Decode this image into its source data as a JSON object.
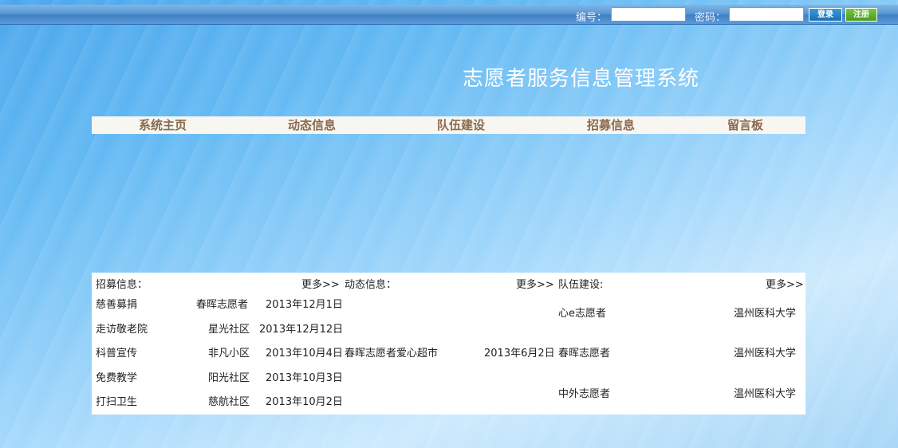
{
  "login": {
    "id_label": "编号：",
    "password_label": "密码：",
    "id_value": "",
    "password_value": "",
    "login_button": "登录",
    "register_button": "注册"
  },
  "site_title": "志愿者服务信息管理系统",
  "nav": [
    "系统主页",
    "动态信息",
    "队伍建设",
    "招募信息",
    "留言板"
  ],
  "recruit": {
    "header": "招募信息：",
    "more": "更多>>",
    "items": [
      {
        "title": "慈善募捐",
        "org": "春晖志愿者",
        "date": "2013年12月1日"
      },
      {
        "title": "走访敬老院",
        "org": "星光社区",
        "date": "2013年12月12日"
      },
      {
        "title": "科普宣传",
        "org": "非凡小区",
        "date": "2013年10月4日"
      },
      {
        "title": "免费教学",
        "org": "阳光社区",
        "date": "2013年10月3日"
      },
      {
        "title": "打扫卫生",
        "org": "慈航社区",
        "date": "2013年10月2日"
      }
    ]
  },
  "news": {
    "header": "动态信息：",
    "more": "更多>>",
    "items": [
      {
        "title": "春晖志愿者爱心超市",
        "date": "2013年6月2日"
      }
    ]
  },
  "team": {
    "header": "队伍建设:",
    "more": "更多>>",
    "items": [
      {
        "name": "心e志愿者",
        "school": "温州医科大学"
      },
      {
        "name": "春晖志愿者",
        "school": "温州医科大学"
      },
      {
        "name": "中外志愿者",
        "school": "温州医科大学"
      }
    ]
  }
}
